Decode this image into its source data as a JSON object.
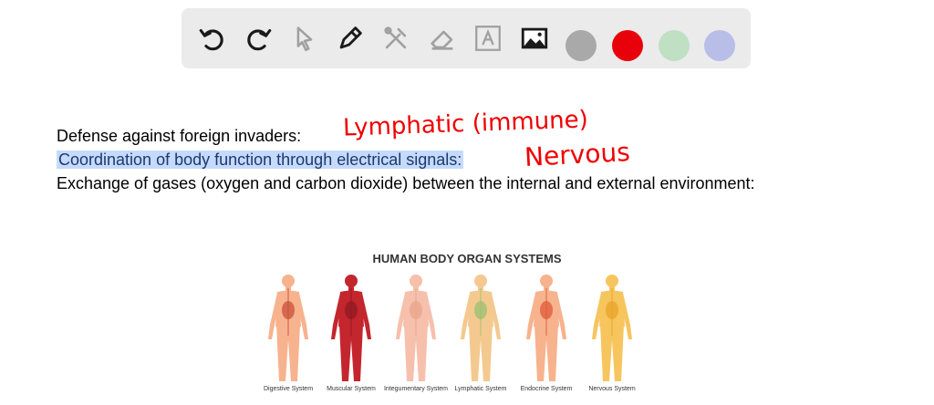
{
  "toolbar": {
    "tools": [
      {
        "name": "undo-icon"
      },
      {
        "name": "redo-icon"
      },
      {
        "name": "select-icon"
      },
      {
        "name": "pen-icon"
      },
      {
        "name": "tools-icon"
      },
      {
        "name": "eraser-icon"
      },
      {
        "name": "text-icon"
      },
      {
        "name": "image-icon"
      }
    ],
    "colors": [
      "#a9a9a9",
      "#e8000b",
      "#bfe0c2",
      "#b9bee8"
    ]
  },
  "lines": {
    "line1": "Defense against foreign invaders:",
    "line2": "Coordination of body function through electrical signals:",
    "line3": "Exchange of gases (oxygen and carbon dioxide) between the internal and external environment:"
  },
  "answers": {
    "a1": "Lymphatic (immune)",
    "a2": "Nervous"
  },
  "figure": {
    "title": "HUMAN BODY ORGAN SYSTEMS",
    "systems": [
      {
        "label": "Digestive System",
        "color": "#f7b38d",
        "accent": "#c94f3a"
      },
      {
        "label": "Muscular System",
        "color": "#c4262e",
        "accent": "#8f1a20"
      },
      {
        "label": "Integumentary System",
        "color": "#f6c0ad",
        "accent": "#e9a48c"
      },
      {
        "label": "Lymphatic System",
        "color": "#f4c98f",
        "accent": "#9bc070"
      },
      {
        "label": "Endocrine System",
        "color": "#f7b38d",
        "accent": "#e05a3a"
      },
      {
        "label": "Nervous System",
        "color": "#f7c55e",
        "accent": "#e8a32a"
      }
    ]
  }
}
